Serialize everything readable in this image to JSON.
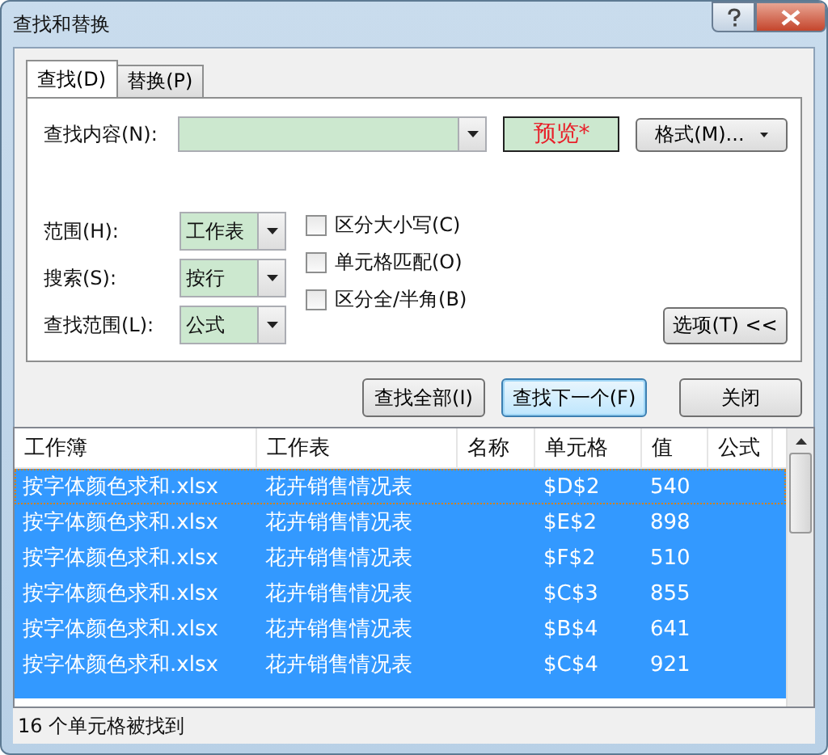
{
  "window": {
    "title": "查找和替换"
  },
  "tabs": [
    {
      "label": "查找(D)",
      "selected": true
    },
    {
      "label": "替换(P)",
      "selected": false
    }
  ],
  "find": {
    "label": "查找内容(N):",
    "preview": "预览*",
    "format_button": "格式(M)..."
  },
  "options": [
    {
      "label": "范围(H):",
      "value": "工作表"
    },
    {
      "label": "搜索(S):",
      "value": "按行"
    },
    {
      "label": "查找范围(L):",
      "value": "公式"
    }
  ],
  "checkboxes": [
    {
      "label": "区分大小写(C)",
      "checked": false
    },
    {
      "label": "单元格匹配(O)",
      "checked": false
    },
    {
      "label": "区分全/半角(B)",
      "checked": false
    }
  ],
  "options_button": "选项(T) <<",
  "buttons": [
    {
      "label": "查找全部(I)",
      "default": false
    },
    {
      "label": "查找下一个(F)",
      "default": true
    },
    {
      "label": "关闭",
      "default": false
    }
  ],
  "results": {
    "columns": [
      "工作簿",
      "工作表",
      "名称",
      "单元格",
      "值",
      "公式"
    ],
    "rows": [
      {
        "cells": [
          "按字体颜色求和.xlsx",
          "花卉销售情况表",
          "",
          "$D$2",
          "540",
          ""
        ],
        "selected": true,
        "focused": true
      },
      {
        "cells": [
          "按字体颜色求和.xlsx",
          "花卉销售情况表",
          "",
          "$E$2",
          "898",
          ""
        ],
        "selected": true,
        "focused": false
      },
      {
        "cells": [
          "按字体颜色求和.xlsx",
          "花卉销售情况表",
          "",
          "$F$2",
          "510",
          ""
        ],
        "selected": true,
        "focused": false
      },
      {
        "cells": [
          "按字体颜色求和.xlsx",
          "花卉销售情况表",
          "",
          "$C$3",
          "855",
          ""
        ],
        "selected": true,
        "focused": false
      },
      {
        "cells": [
          "按字体颜色求和.xlsx",
          "花卉销售情况表",
          "",
          "$B$4",
          "641",
          ""
        ],
        "selected": true,
        "focused": false
      },
      {
        "cells": [
          "按字体颜色求和.xlsx",
          "花卉销售情况表",
          "",
          "$C$4",
          "921",
          ""
        ],
        "selected": true,
        "focused": false
      }
    ]
  },
  "status_bar": "16 个单元格被找到"
}
